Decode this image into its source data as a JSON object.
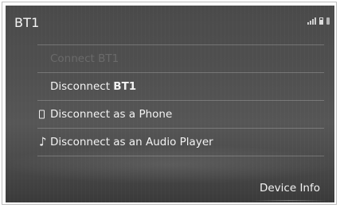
{
  "screen": {
    "title": "BT1"
  },
  "menu": {
    "connect_label": "Connect BT1",
    "disconnect_prefix": "Disconnect ",
    "disconnect_device": "BT1",
    "disconnect_phone_label": "Disconnect as a Phone",
    "disconnect_audio_label": "Disconnect as an Audio Player"
  },
  "footer": {
    "device_info_label": "Device Info"
  },
  "icons": {
    "phone": "phone-icon",
    "audio": "music-note-icon",
    "signal": "signal-strength-icon",
    "battery": "battery-icon",
    "bluetooth": "bluetooth-icon"
  },
  "colors": {
    "background": "#505050",
    "text": "#f3f3f3",
    "disabled_text": "#6a6a6a"
  }
}
